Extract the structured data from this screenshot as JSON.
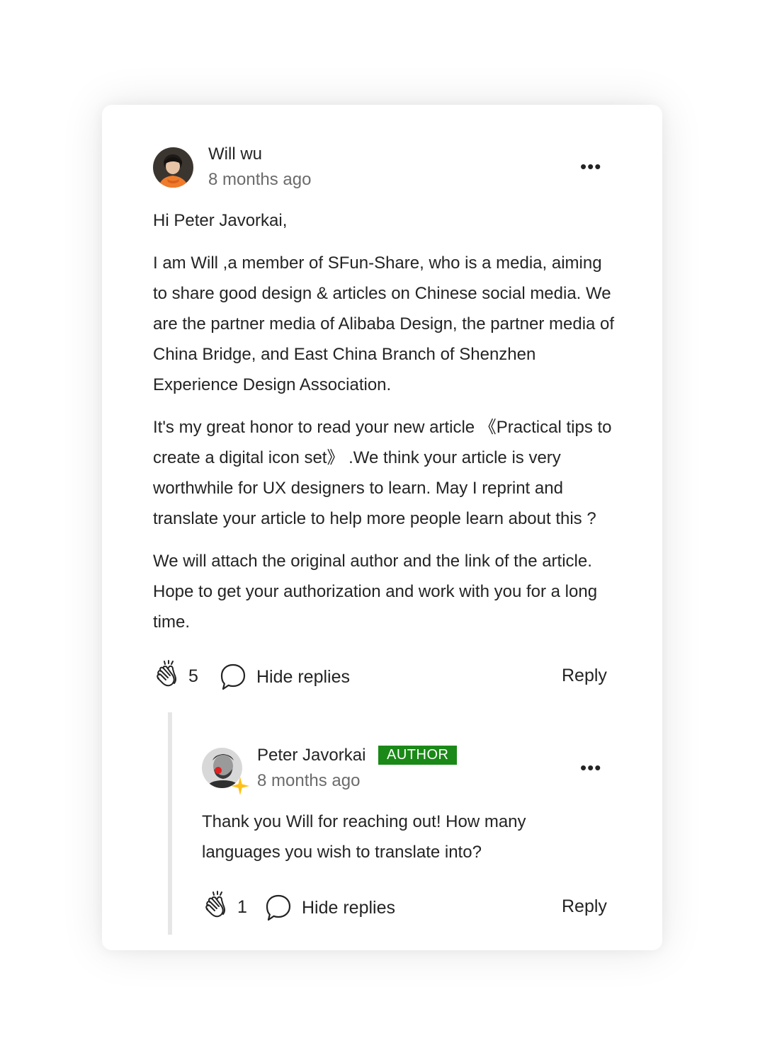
{
  "comment": {
    "author": "Will wu",
    "time": "8 months ago",
    "greeting": "Hi Peter Javorkai,",
    "paragraphs": [
      "I am Will ,a member of SFun-Share, who is a media, aiming to share good design & articles on Chinese social media. We are the partner media of Alibaba Design, the partner media of China Bridge, and East China Branch of Shenzhen Experience Design Association.",
      "It's my great honor to read your new article 《Practical tips to create a digital icon set》 .We think your article is very worthwhile for UX designers to learn. May I reprint and translate your article to help more people learn about this ?",
      "We will attach the original author and the link of the article. Hope to get your authorization and work with you for a long time."
    ],
    "claps": "5",
    "hide_replies": "Hide replies",
    "reply": "Reply",
    "more": "•••"
  },
  "reply_comment": {
    "author": "Peter Javorkai",
    "badge": "AUTHOR",
    "time": "8 months ago",
    "text": "Thank you Will for reaching out! How many languages you wish to translate into?",
    "claps": "1",
    "hide_replies": "Hide replies",
    "reply": "Reply",
    "more": "•••"
  },
  "colors": {
    "badge_bg": "#1a8917",
    "text": "#242424",
    "muted": "#6b6b6b",
    "thread_line": "#e6e6e6",
    "star": "#ffc017"
  },
  "icons": [
    "clap-icon",
    "speech-bubble-icon",
    "more-icon",
    "star-icon"
  ]
}
